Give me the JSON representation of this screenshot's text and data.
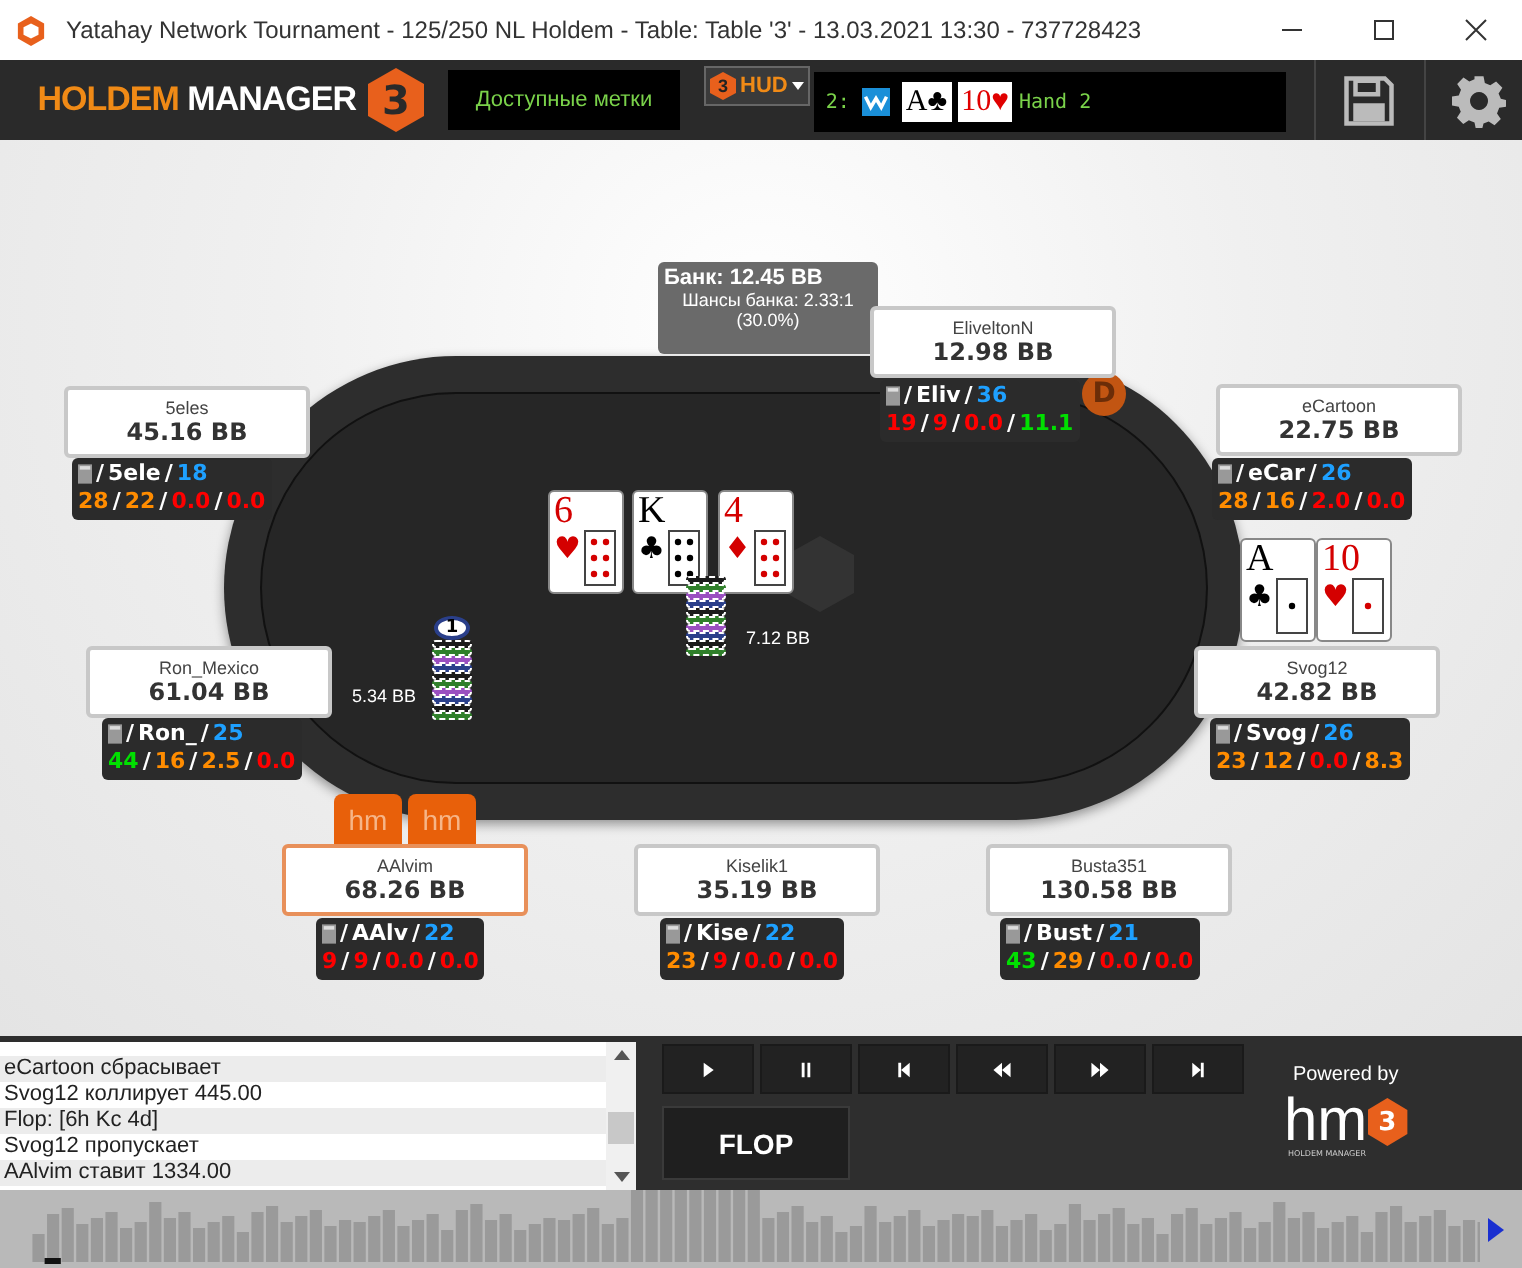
{
  "window": {
    "title": "Yatahay Network Tournament - 125/250 NL Holdem - Table: Table '3' - 13.03.2021 13:30 - 737728423"
  },
  "toolbar": {
    "logo": {
      "word1": "HOLDEM",
      "word2": "MANAGER",
      "mark": "3"
    },
    "tags_label": "Доступные метки",
    "hud_button": {
      "mark": "3",
      "label": "HUD"
    },
    "hand_info": {
      "seat": "2:",
      "cards": [
        {
          "rank": "A",
          "suit": "♣",
          "color": "#000000"
        },
        {
          "rank": "10",
          "suit": "♥",
          "color": "#e00000"
        }
      ],
      "label": "Hand 2"
    }
  },
  "table": {
    "pot": {
      "title": "Банк: 12.45 BB",
      "odds": "Шансы банка: 2.33:1",
      "percent": "(30.0%)"
    },
    "board": [
      {
        "rank": "6",
        "suit": "♥",
        "color": "#d40000"
      },
      {
        "rank": "K",
        "suit": "♣",
        "color": "#000000"
      },
      {
        "rank": "4",
        "suit": "♦",
        "color": "#d40000"
      }
    ],
    "hero_cards": [
      {
        "rank": "A",
        "suit": "♣",
        "color": "#000000"
      },
      {
        "rank": "10",
        "suit": "♥",
        "color": "#d40000"
      }
    ],
    "bets": [
      {
        "amount": "5.34 BB",
        "chip_label": "1"
      },
      {
        "amount": "7.12 BB"
      }
    ],
    "dealer_button": "D",
    "hm_tabs": [
      "hm",
      "hm"
    ],
    "seats": [
      {
        "name": "5eles",
        "stack": "45.16 BB",
        "active": false,
        "hud": [
          [
            {
              "text": "/",
              "color": "#ffffff"
            },
            {
              "text": "5ele",
              "color": "#ffffff"
            },
            {
              "text": "/",
              "color": "#ffffff"
            },
            {
              "text": "18",
              "color": "#1ea0ff"
            }
          ],
          [
            {
              "text": "28",
              "color": "#ff8c00"
            },
            {
              "text": "/",
              "color": "#ffffff"
            },
            {
              "text": "22",
              "color": "#ff8c00"
            },
            {
              "text": "/",
              "color": "#ffffff"
            },
            {
              "text": "0.0",
              "color": "#ff0000"
            },
            {
              "text": "/",
              "color": "#ffffff"
            },
            {
              "text": "0.0",
              "color": "#ff0000"
            }
          ]
        ]
      },
      {
        "name": "EliveltonN",
        "stack": "12.98 BB",
        "active": false,
        "hud": [
          [
            {
              "text": "/",
              "color": "#ffffff"
            },
            {
              "text": "Eliv",
              "color": "#ffffff"
            },
            {
              "text": "/",
              "color": "#ffffff"
            },
            {
              "text": "36",
              "color": "#1ea0ff"
            }
          ],
          [
            {
              "text": "19",
              "color": "#ff0000"
            },
            {
              "text": "/",
              "color": "#ffffff"
            },
            {
              "text": "9",
              "color": "#ff0000"
            },
            {
              "text": "/",
              "color": "#ffffff"
            },
            {
              "text": "0.0",
              "color": "#ff0000"
            },
            {
              "text": "/",
              "color": "#ffffff"
            },
            {
              "text": "11.1",
              "color": "#00e000"
            }
          ]
        ]
      },
      {
        "name": "eCartoon",
        "stack": "22.75 BB",
        "active": false,
        "hud": [
          [
            {
              "text": "/",
              "color": "#ffffff"
            },
            {
              "text": "eCar",
              "color": "#ffffff"
            },
            {
              "text": "/",
              "color": "#ffffff"
            },
            {
              "text": "26",
              "color": "#1ea0ff"
            }
          ],
          [
            {
              "text": "28",
              "color": "#ff8c00"
            },
            {
              "text": "/",
              "color": "#ffffff"
            },
            {
              "text": "16",
              "color": "#ff8c00"
            },
            {
              "text": "/",
              "color": "#ffffff"
            },
            {
              "text": "2.0",
              "color": "#ff0000"
            },
            {
              "text": "/",
              "color": "#ffffff"
            },
            {
              "text": "0.0",
              "color": "#ff0000"
            }
          ]
        ]
      },
      {
        "name": "Ron_Mexico",
        "stack": "61.04 BB",
        "active": false,
        "hud": [
          [
            {
              "text": "/",
              "color": "#ffffff"
            },
            {
              "text": "Ron_",
              "color": "#ffffff"
            },
            {
              "text": "/",
              "color": "#ffffff"
            },
            {
              "text": "25",
              "color": "#1ea0ff"
            }
          ],
          [
            {
              "text": "44",
              "color": "#00e000"
            },
            {
              "text": "/",
              "color": "#ffffff"
            },
            {
              "text": "16",
              "color": "#ff8c00"
            },
            {
              "text": "/",
              "color": "#ffffff"
            },
            {
              "text": "2.5",
              "color": "#ff8c00"
            },
            {
              "text": "/",
              "color": "#ffffff"
            },
            {
              "text": "0.0",
              "color": "#ff0000"
            }
          ]
        ]
      },
      {
        "name": "Svog12",
        "stack": "42.82 BB",
        "active": false,
        "hud": [
          [
            {
              "text": "/",
              "color": "#ffffff"
            },
            {
              "text": "Svog",
              "color": "#ffffff"
            },
            {
              "text": "/",
              "color": "#ffffff"
            },
            {
              "text": "26",
              "color": "#1ea0ff"
            }
          ],
          [
            {
              "text": "23",
              "color": "#ff8c00"
            },
            {
              "text": "/",
              "color": "#ffffff"
            },
            {
              "text": "12",
              "color": "#ff8c00"
            },
            {
              "text": "/",
              "color": "#ffffff"
            },
            {
              "text": "0.0",
              "color": "#ff0000"
            },
            {
              "text": "/",
              "color": "#ffffff"
            },
            {
              "text": "8.3",
              "color": "#ff8c00"
            }
          ]
        ]
      },
      {
        "name": "AAlvim",
        "stack": "68.26 BB",
        "active": true,
        "hud": [
          [
            {
              "text": "/",
              "color": "#ffffff"
            },
            {
              "text": "AAlv",
              "color": "#ffffff"
            },
            {
              "text": "/",
              "color": "#ffffff"
            },
            {
              "text": "22",
              "color": "#1ea0ff"
            }
          ],
          [
            {
              "text": "9",
              "color": "#ff0000"
            },
            {
              "text": "/",
              "color": "#ffffff"
            },
            {
              "text": "9",
              "color": "#ff0000"
            },
            {
              "text": "/",
              "color": "#ffffff"
            },
            {
              "text": "0.0",
              "color": "#ff0000"
            },
            {
              "text": "/",
              "color": "#ffffff"
            },
            {
              "text": "0.0",
              "color": "#ff0000"
            }
          ]
        ]
      },
      {
        "name": "Kiselik1",
        "stack": "35.19 BB",
        "active": false,
        "hud": [
          [
            {
              "text": "/",
              "color": "#ffffff"
            },
            {
              "text": "Kise",
              "color": "#ffffff"
            },
            {
              "text": "/",
              "color": "#ffffff"
            },
            {
              "text": "22",
              "color": "#1ea0ff"
            }
          ],
          [
            {
              "text": "23",
              "color": "#ff8c00"
            },
            {
              "text": "/",
              "color": "#ffffff"
            },
            {
              "text": "9",
              "color": "#ff0000"
            },
            {
              "text": "/",
              "color": "#ffffff"
            },
            {
              "text": "0.0",
              "color": "#ff0000"
            },
            {
              "text": "/",
              "color": "#ffffff"
            },
            {
              "text": "0.0",
              "color": "#ff0000"
            }
          ]
        ]
      },
      {
        "name": "Busta351",
        "stack": "130.58 BB",
        "active": false,
        "hud": [
          [
            {
              "text": "/",
              "color": "#ffffff"
            },
            {
              "text": "Bust",
              "color": "#ffffff"
            },
            {
              "text": "/",
              "color": "#ffffff"
            },
            {
              "text": "21",
              "color": "#1ea0ff"
            }
          ],
          [
            {
              "text": "43",
              "color": "#00e000"
            },
            {
              "text": "/",
              "color": "#ffffff"
            },
            {
              "text": "29",
              "color": "#ff8c00"
            },
            {
              "text": "/",
              "color": "#ffffff"
            },
            {
              "text": "0.0",
              "color": "#ff0000"
            },
            {
              "text": "/",
              "color": "#ffffff"
            },
            {
              "text": "0.0",
              "color": "#ff0000"
            }
          ]
        ]
      }
    ]
  },
  "action_log": [
    "eCartoon сбрасывает",
    "Svog12 коллирует 445.00",
    "Flop: [6h Kc 4d]",
    "Svog12 пропускает",
    "AAlvim ставит 1334.00"
  ],
  "playback": {
    "controls": [
      {
        "kind": "play"
      },
      {
        "kind": "pause"
      },
      {
        "kind": "first"
      },
      {
        "kind": "back"
      },
      {
        "kind": "forward"
      },
      {
        "kind": "last"
      }
    ],
    "street_button": "FLOP"
  },
  "branding": {
    "caption": "Powered by",
    "logo_text": "hm",
    "logo_mark": "3",
    "logo_sub": "HOLDEM MANAGER"
  }
}
